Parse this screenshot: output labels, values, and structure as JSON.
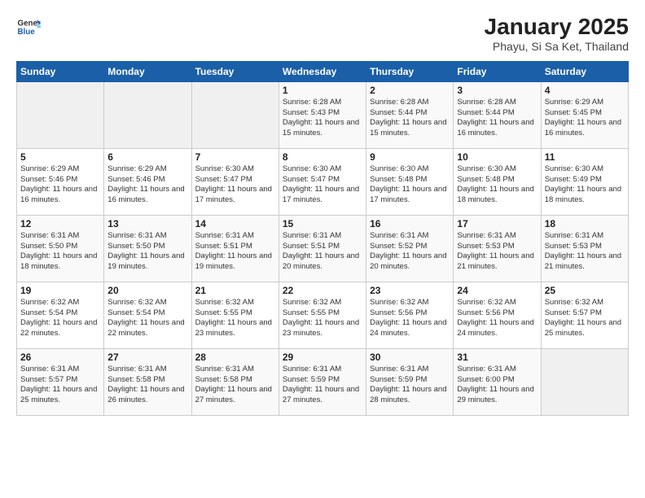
{
  "logo": {
    "text_general": "General",
    "text_blue": "Blue"
  },
  "header": {
    "title": "January 2025",
    "subtitle": "Phayu, Si Sa Ket, Thailand"
  },
  "weekdays": [
    "Sunday",
    "Monday",
    "Tuesday",
    "Wednesday",
    "Thursday",
    "Friday",
    "Saturday"
  ],
  "weeks": [
    [
      {
        "day": "",
        "sunrise": "",
        "sunset": "",
        "daylight": ""
      },
      {
        "day": "",
        "sunrise": "",
        "sunset": "",
        "daylight": ""
      },
      {
        "day": "",
        "sunrise": "",
        "sunset": "",
        "daylight": ""
      },
      {
        "day": "1",
        "sunrise": "Sunrise: 6:28 AM",
        "sunset": "Sunset: 5:43 PM",
        "daylight": "Daylight: 11 hours and 15 minutes."
      },
      {
        "day": "2",
        "sunrise": "Sunrise: 6:28 AM",
        "sunset": "Sunset: 5:44 PM",
        "daylight": "Daylight: 11 hours and 15 minutes."
      },
      {
        "day": "3",
        "sunrise": "Sunrise: 6:28 AM",
        "sunset": "Sunset: 5:44 PM",
        "daylight": "Daylight: 11 hours and 16 minutes."
      },
      {
        "day": "4",
        "sunrise": "Sunrise: 6:29 AM",
        "sunset": "Sunset: 5:45 PM",
        "daylight": "Daylight: 11 hours and 16 minutes."
      }
    ],
    [
      {
        "day": "5",
        "sunrise": "Sunrise: 6:29 AM",
        "sunset": "Sunset: 5:46 PM",
        "daylight": "Daylight: 11 hours and 16 minutes."
      },
      {
        "day": "6",
        "sunrise": "Sunrise: 6:29 AM",
        "sunset": "Sunset: 5:46 PM",
        "daylight": "Daylight: 11 hours and 16 minutes."
      },
      {
        "day": "7",
        "sunrise": "Sunrise: 6:30 AM",
        "sunset": "Sunset: 5:47 PM",
        "daylight": "Daylight: 11 hours and 17 minutes."
      },
      {
        "day": "8",
        "sunrise": "Sunrise: 6:30 AM",
        "sunset": "Sunset: 5:47 PM",
        "daylight": "Daylight: 11 hours and 17 minutes."
      },
      {
        "day": "9",
        "sunrise": "Sunrise: 6:30 AM",
        "sunset": "Sunset: 5:48 PM",
        "daylight": "Daylight: 11 hours and 17 minutes."
      },
      {
        "day": "10",
        "sunrise": "Sunrise: 6:30 AM",
        "sunset": "Sunset: 5:48 PM",
        "daylight": "Daylight: 11 hours and 18 minutes."
      },
      {
        "day": "11",
        "sunrise": "Sunrise: 6:30 AM",
        "sunset": "Sunset: 5:49 PM",
        "daylight": "Daylight: 11 hours and 18 minutes."
      }
    ],
    [
      {
        "day": "12",
        "sunrise": "Sunrise: 6:31 AM",
        "sunset": "Sunset: 5:50 PM",
        "daylight": "Daylight: 11 hours and 18 minutes."
      },
      {
        "day": "13",
        "sunrise": "Sunrise: 6:31 AM",
        "sunset": "Sunset: 5:50 PM",
        "daylight": "Daylight: 11 hours and 19 minutes."
      },
      {
        "day": "14",
        "sunrise": "Sunrise: 6:31 AM",
        "sunset": "Sunset: 5:51 PM",
        "daylight": "Daylight: 11 hours and 19 minutes."
      },
      {
        "day": "15",
        "sunrise": "Sunrise: 6:31 AM",
        "sunset": "Sunset: 5:51 PM",
        "daylight": "Daylight: 11 hours and 20 minutes."
      },
      {
        "day": "16",
        "sunrise": "Sunrise: 6:31 AM",
        "sunset": "Sunset: 5:52 PM",
        "daylight": "Daylight: 11 hours and 20 minutes."
      },
      {
        "day": "17",
        "sunrise": "Sunrise: 6:31 AM",
        "sunset": "Sunset: 5:53 PM",
        "daylight": "Daylight: 11 hours and 21 minutes."
      },
      {
        "day": "18",
        "sunrise": "Sunrise: 6:31 AM",
        "sunset": "Sunset: 5:53 PM",
        "daylight": "Daylight: 11 hours and 21 minutes."
      }
    ],
    [
      {
        "day": "19",
        "sunrise": "Sunrise: 6:32 AM",
        "sunset": "Sunset: 5:54 PM",
        "daylight": "Daylight: 11 hours and 22 minutes."
      },
      {
        "day": "20",
        "sunrise": "Sunrise: 6:32 AM",
        "sunset": "Sunset: 5:54 PM",
        "daylight": "Daylight: 11 hours and 22 minutes."
      },
      {
        "day": "21",
        "sunrise": "Sunrise: 6:32 AM",
        "sunset": "Sunset: 5:55 PM",
        "daylight": "Daylight: 11 hours and 23 minutes."
      },
      {
        "day": "22",
        "sunrise": "Sunrise: 6:32 AM",
        "sunset": "Sunset: 5:55 PM",
        "daylight": "Daylight: 11 hours and 23 minutes."
      },
      {
        "day": "23",
        "sunrise": "Sunrise: 6:32 AM",
        "sunset": "Sunset: 5:56 PM",
        "daylight": "Daylight: 11 hours and 24 minutes."
      },
      {
        "day": "24",
        "sunrise": "Sunrise: 6:32 AM",
        "sunset": "Sunset: 5:56 PM",
        "daylight": "Daylight: 11 hours and 24 minutes."
      },
      {
        "day": "25",
        "sunrise": "Sunrise: 6:32 AM",
        "sunset": "Sunset: 5:57 PM",
        "daylight": "Daylight: 11 hours and 25 minutes."
      }
    ],
    [
      {
        "day": "26",
        "sunrise": "Sunrise: 6:31 AM",
        "sunset": "Sunset: 5:57 PM",
        "daylight": "Daylight: 11 hours and 25 minutes."
      },
      {
        "day": "27",
        "sunrise": "Sunrise: 6:31 AM",
        "sunset": "Sunset: 5:58 PM",
        "daylight": "Daylight: 11 hours and 26 minutes."
      },
      {
        "day": "28",
        "sunrise": "Sunrise: 6:31 AM",
        "sunset": "Sunset: 5:58 PM",
        "daylight": "Daylight: 11 hours and 27 minutes."
      },
      {
        "day": "29",
        "sunrise": "Sunrise: 6:31 AM",
        "sunset": "Sunset: 5:59 PM",
        "daylight": "Daylight: 11 hours and 27 minutes."
      },
      {
        "day": "30",
        "sunrise": "Sunrise: 6:31 AM",
        "sunset": "Sunset: 5:59 PM",
        "daylight": "Daylight: 11 hours and 28 minutes."
      },
      {
        "day": "31",
        "sunrise": "Sunrise: 6:31 AM",
        "sunset": "Sunset: 6:00 PM",
        "daylight": "Daylight: 11 hours and 29 minutes."
      },
      {
        "day": "",
        "sunrise": "",
        "sunset": "",
        "daylight": ""
      }
    ]
  ]
}
